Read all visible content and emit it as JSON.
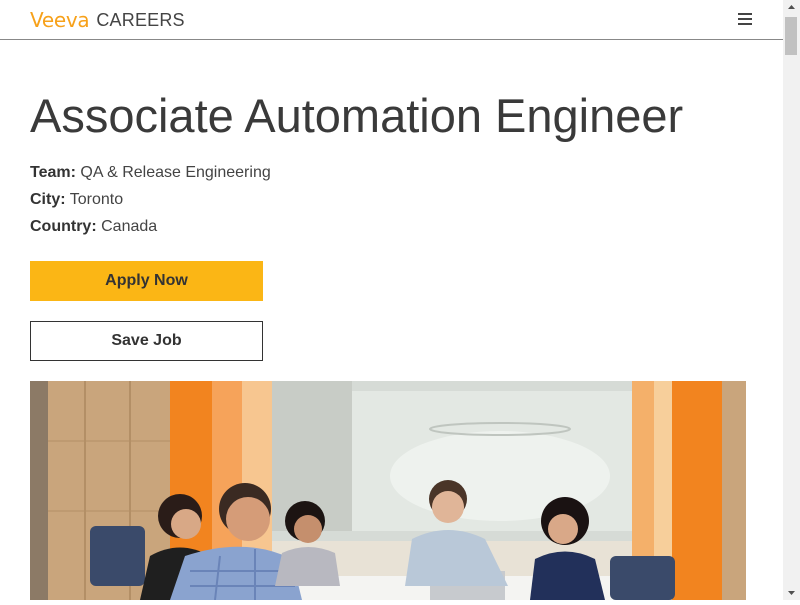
{
  "header": {
    "brand": "Veeva",
    "section": "CAREERS",
    "menu_icon": "hamburger-menu-icon"
  },
  "job": {
    "title": "Associate Automation Engineer",
    "team_label": "Team:",
    "team_value": "QA & Release Engineering",
    "city_label": "City:",
    "city_value": "Toronto",
    "country_label": "Country:",
    "country_value": "Canada"
  },
  "actions": {
    "apply_label": "Apply Now",
    "save_label": "Save Job"
  },
  "photo": {
    "subject": "team-meeting-photo"
  },
  "colors": {
    "brand_orange": "#f7a11a",
    "apply_yellow": "#fbb615",
    "text_dark": "#3a3a3a"
  }
}
